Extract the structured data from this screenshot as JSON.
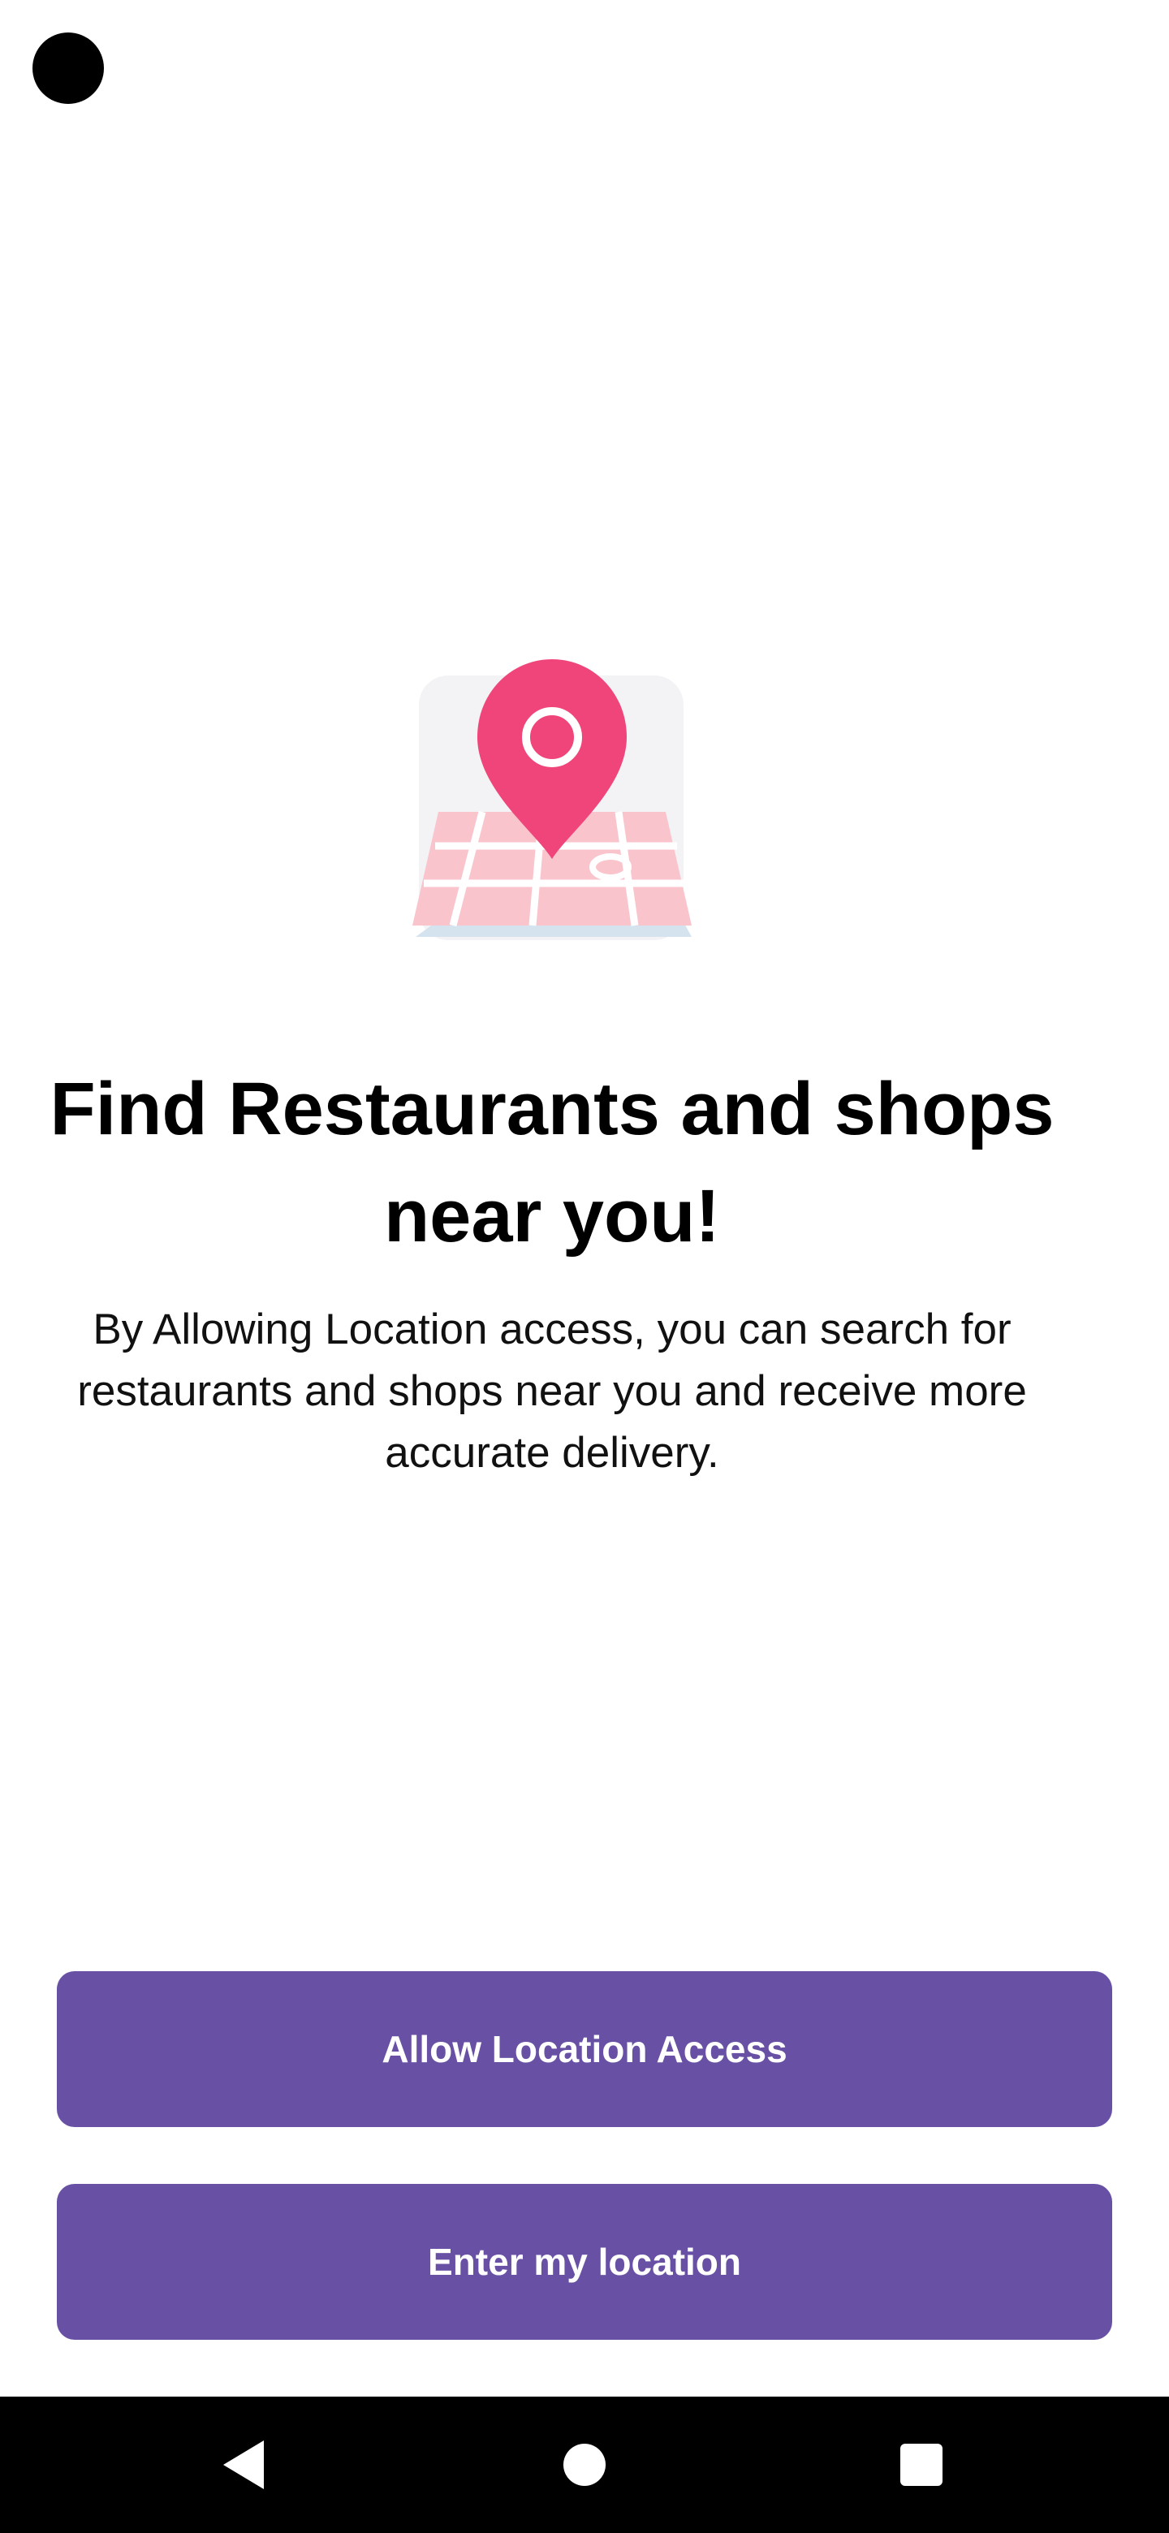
{
  "screen": {
    "title": "Find Restaurants and shops near you!",
    "description": "By Allowing Location access, you can search for restaurants and shops near you and receive more accurate delivery.",
    "illustration_icon": "map-location-pin-icon"
  },
  "actions": {
    "allow_label": "Allow Location Access",
    "enter_label": "Enter my location"
  },
  "colors": {
    "primary": "#6851A4",
    "pin": "#F0457A",
    "map": "#F9C4CC",
    "background": "#FFFFFF"
  },
  "system_nav": {
    "back_icon": "back-triangle-icon",
    "home_icon": "home-circle-icon",
    "recents_icon": "recents-square-icon"
  }
}
